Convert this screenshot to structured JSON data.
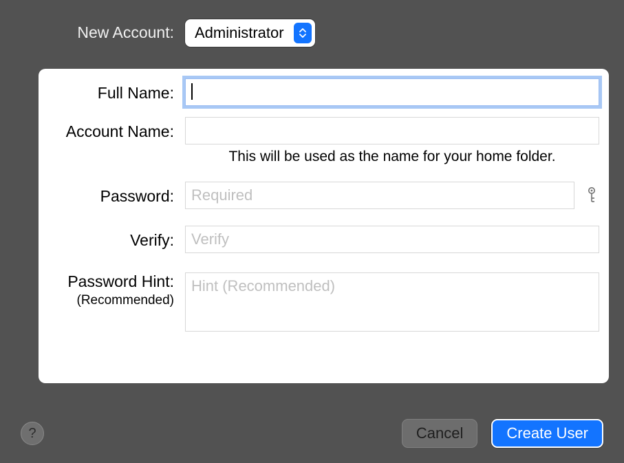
{
  "labels": {
    "new_account": "New Account:",
    "full_name": "Full Name:",
    "account_name": "Account Name:",
    "password": "Password:",
    "verify": "Verify:",
    "password_hint": "Password Hint:",
    "recommended": "(Recommended)"
  },
  "account_type": {
    "selected": "Administrator"
  },
  "hints": {
    "account_name": "This will be used as the name for your home folder."
  },
  "placeholders": {
    "password": "Required",
    "verify": "Verify",
    "hint": "Hint (Recommended)"
  },
  "values": {
    "full_name": "",
    "account_name": "",
    "password": "",
    "verify": "",
    "hint": ""
  },
  "buttons": {
    "help": "?",
    "cancel": "Cancel",
    "create_user": "Create User"
  },
  "icons": {
    "dropdown": "chevron-up-down-icon",
    "password_key": "key-icon"
  },
  "colors": {
    "accent": "#1374ff",
    "background": "#525252",
    "focus_ring": "#a8c8f5"
  }
}
